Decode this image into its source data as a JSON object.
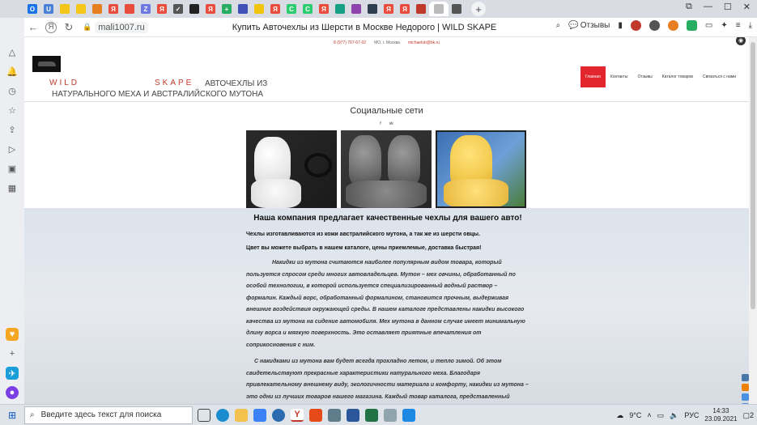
{
  "browser": {
    "url": "mali1007.ru",
    "page_title": "Купить Авточехлы из Шерсти в Москве Недорого | WILD SKAPE",
    "reviews_label": "Отзывы"
  },
  "tabs": [
    {
      "icon": "o-icon",
      "color": "#1a73e8",
      "glyph": "O"
    },
    {
      "icon": "u-icon",
      "color": "#4a7fd6",
      "glyph": "U"
    },
    {
      "icon": "taxi-icon",
      "color": "#f5c518",
      "glyph": ""
    },
    {
      "icon": "taxi-icon",
      "color": "#f5c518",
      "glyph": ""
    },
    {
      "icon": "square-icon",
      "color": "#e67e22",
      "glyph": ""
    },
    {
      "icon": "yandex-icon",
      "color": "#e74c3c",
      "glyph": "Я"
    },
    {
      "icon": "flag-icon",
      "color": "#e74c3c",
      "glyph": ""
    },
    {
      "icon": "z-icon",
      "color": "#6c7ae0",
      "glyph": "Z"
    },
    {
      "icon": "yandex-icon",
      "color": "#e74c3c",
      "glyph": "Я"
    },
    {
      "icon": "check-icon",
      "color": "#555555",
      "glyph": "✓"
    },
    {
      "icon": "black-icon",
      "color": "#222222",
      "glyph": ""
    },
    {
      "icon": "yandex-icon",
      "color": "#e74c3c",
      "glyph": "Я"
    },
    {
      "icon": "plus-icon",
      "color": "#27ae60",
      "glyph": "+"
    },
    {
      "icon": "doc-icon",
      "color": "#3f51b5",
      "glyph": ""
    },
    {
      "icon": "yellow-icon",
      "color": "#f1c40f",
      "glyph": ""
    },
    {
      "icon": "yandex-icon",
      "color": "#e74c3c",
      "glyph": "Я"
    },
    {
      "icon": "c-icon",
      "color": "#2ecc71",
      "glyph": "C"
    },
    {
      "icon": "c-icon",
      "color": "#2ecc71",
      "glyph": "C"
    },
    {
      "icon": "yandex-icon",
      "color": "#e74c3c",
      "glyph": "Я"
    },
    {
      "icon": "tag-icon",
      "color": "#16a085",
      "glyph": ""
    },
    {
      "icon": "purple-icon",
      "color": "#8e44ad",
      "glyph": ""
    },
    {
      "icon": "flag-icon",
      "color": "#2c3e50",
      "glyph": ""
    },
    {
      "icon": "yandex-icon",
      "color": "#e74c3c",
      "glyph": "Я"
    },
    {
      "icon": "yandex-icon",
      "color": "#e74c3c",
      "glyph": "Я"
    },
    {
      "icon": "drop-icon",
      "color": "#c0392b",
      "glyph": ""
    },
    {
      "icon": "gear-icon",
      "color": "#555555",
      "glyph": ""
    }
  ],
  "site": {
    "phone": "8 (977) 767-67-02",
    "city": "МО, г. Москва",
    "email": "michaelub@bk.ru",
    "brand_left": "WILD",
    "brand_right": "SKAPE",
    "brand_tail": "АВТОЧЕХЛЫ ИЗ",
    "tagline": "НАТУРАЛЬНОГО МЕХА И АВСТРАЛИЙСКОГО МУТОНА",
    "menu": [
      "Главная",
      "Контакты",
      "Отзывы",
      "Каталог товаров",
      "Связаться с нами"
    ],
    "social_title": "Социальные сети",
    "social_icons": [
      "f",
      "vk"
    ],
    "offer_heading": "Наша компания предлагает качественные чехлы для вашего авто!",
    "para1": "Чехлы изготавливаются из кожи австралийского мутона, а так же из шерсти овцы.",
    "para2": "Цвет вы можете выбрать в нашем каталоге, цены приемлемые, доставка быстрая!",
    "para3": "Накидки из мутона считаются наиболее популярным видом товара, который пользуется спросом среди многих автовладельцев. Мутон – мех овчины, обработанный по особой технологии, в которой используется специализированный водный раствор – формалин. Каждый ворс, обработанный формалином, становится прочным, выдерживая внешние воздействия окружающей среды. В нашем каталоге представлены накидки высокого качества из мутона на сидение автомобиля.  Мех мутона в данном случае имеет минимальную длину ворса и мягкую поверхность. Это оставляет приятные впечатления от соприкосновения с ним.",
    "para4": "С накидками из мутона вам будет всегда прохладно летом, и тепло зимой. Об этом свидетельствуют прекрасные характеристики натурального меха. Благодаря привлекательному внешнему виду, экологичности материала и комфорту, накидки из мутона – это одни из лучших товаров нашего магазина. Каждый товар каталога, представленный"
  },
  "taskbar": {
    "search_placeholder": "Введите здесь текст для поиска",
    "weather": "9°C",
    "lang": "РУС",
    "time": "14:33",
    "date": "23.09.2021",
    "notifications": "2"
  },
  "colors": {
    "accent_red": "#e3262d",
    "brand_red": "#c0392b"
  }
}
